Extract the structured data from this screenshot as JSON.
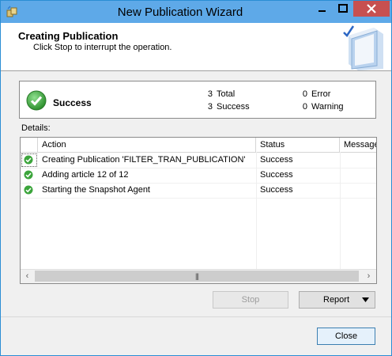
{
  "window": {
    "title": "New Publication Wizard"
  },
  "header": {
    "title": "Creating Publication",
    "subtitle": "Click Stop to interrupt the operation."
  },
  "summary": {
    "status": "Success",
    "stats": [
      {
        "count": "3",
        "label": "Total"
      },
      {
        "count": "3",
        "label": "Success"
      },
      {
        "count": "0",
        "label": "Error"
      },
      {
        "count": "0",
        "label": "Warning"
      }
    ]
  },
  "details": {
    "label": "Details:",
    "columns": [
      "Action",
      "Status",
      "Message"
    ],
    "rows": [
      {
        "action": "Creating Publication 'FILTER_TRAN_PUBLICATION'",
        "status": "Success",
        "message": ""
      },
      {
        "action": "Adding article 12 of 12",
        "status": "Success",
        "message": ""
      },
      {
        "action": "Starting the Snapshot Agent",
        "status": "Success",
        "message": ""
      }
    ]
  },
  "buttons": {
    "stop": "Stop",
    "report": "Report",
    "close": "Close"
  },
  "colors": {
    "titlebar": "#5ea9e8",
    "close_button": "#c75050",
    "success_green": "#3ca53c"
  }
}
